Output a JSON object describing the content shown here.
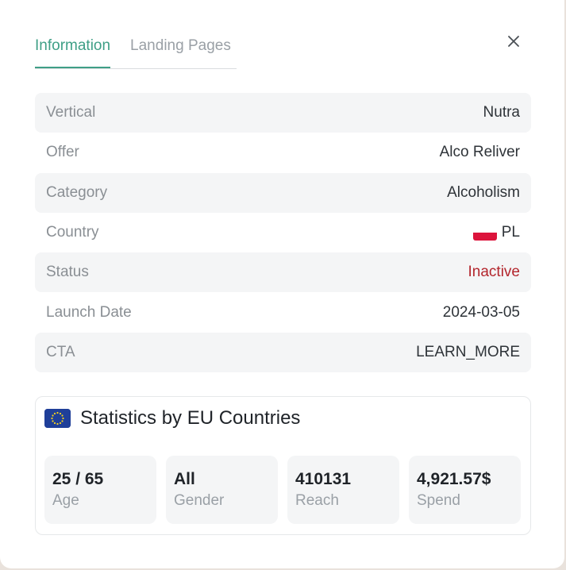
{
  "tabs": [
    {
      "label": "Information",
      "active": true
    },
    {
      "label": "Landing Pages",
      "active": false
    }
  ],
  "info": {
    "vertical": {
      "label": "Vertical",
      "value": "Nutra"
    },
    "offer": {
      "label": "Offer",
      "value": "Alco Reliver"
    },
    "category": {
      "label": "Category",
      "value": "Alcoholism"
    },
    "country": {
      "label": "Country",
      "value": "PL",
      "flag_icon": "poland-flag-icon"
    },
    "status": {
      "label": "Status",
      "value": "Inactive",
      "color": "#b3262d"
    },
    "launch_date": {
      "label": "Launch Date",
      "value": "2024-03-05"
    },
    "cta": {
      "label": "CTA",
      "value": "LEARN_MORE"
    }
  },
  "stats": {
    "flag_icon": "eu-flag-icon",
    "title": "Statistics by EU Countries",
    "cards": [
      {
        "value": "25 / 65",
        "label": "Age"
      },
      {
        "value": "All",
        "label": "Gender"
      },
      {
        "value": "410131",
        "label": "Reach"
      },
      {
        "value": "4,921.57$",
        "label": "Spend"
      }
    ]
  },
  "colors": {
    "accent": "#3f9f86",
    "inactive": "#b3262d"
  }
}
